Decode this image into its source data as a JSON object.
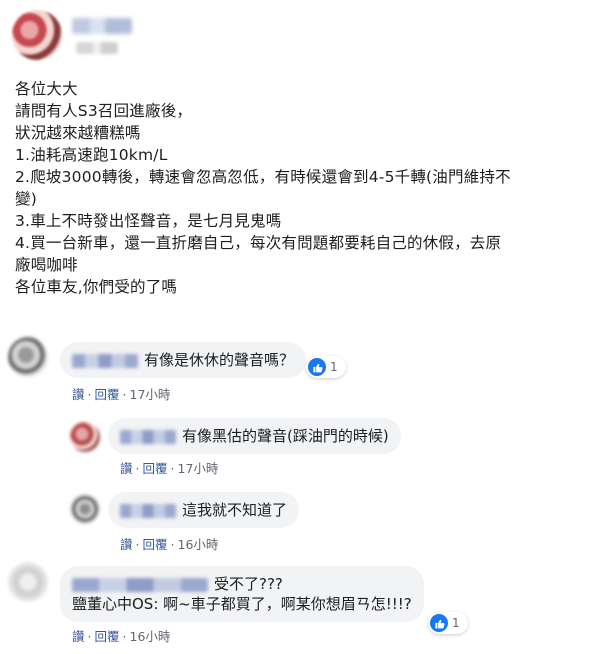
{
  "post": {
    "lines": [
      "各位大大",
      "請問有人S3召回進廠後，",
      "狀況越來越糟糕嗎",
      "1.油耗高速跑10km/L",
      "2.爬坡3000轉後，轉速會忽高忽低，有時候還會到4-5千轉(油門維持不",
      "變)",
      "3.車上不時發出怪聲音，是七月見鬼嗎",
      "4.買一台新車，還一直折磨自己，每次有問題都要耗自己的休假，去原",
      "廠喝咖啡",
      "各位車友,你們受的了嗎"
    ]
  },
  "comments": [
    {
      "text": "有像是休休的聲音嗎？",
      "like": "讚",
      "reply": "回覆",
      "time": "17小時",
      "reactions": "1"
    },
    {
      "text": "有像黑估的聲音(踩油門的時候)",
      "like": "讚",
      "reply": "回覆",
      "time": "17小時"
    },
    {
      "text": "這我就不知道了",
      "like": "讚",
      "reply": "回覆",
      "time": "16小時"
    },
    {
      "text_line1": "受不了???",
      "text_line2": "鹽董心中OS: 啊~車子都買了，啊某你想眉ㄢ怎!!!?",
      "like": "讚",
      "reply": "回覆",
      "time": "16小時",
      "reactions": "1"
    }
  ],
  "colors": {
    "link": "#385898",
    "bubble": "#f2f3f5",
    "like_blue": "#1877f2"
  },
  "icons": {
    "reaction": "thumbs-up-icon"
  }
}
